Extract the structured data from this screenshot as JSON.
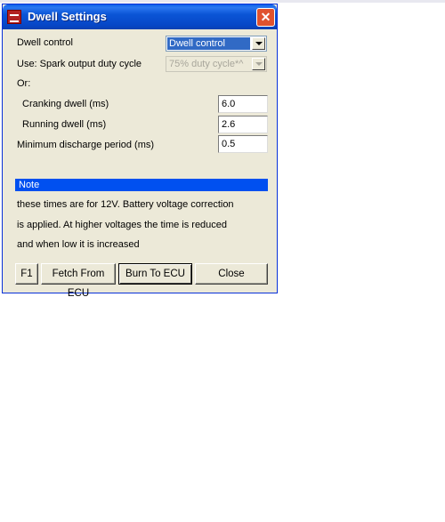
{
  "window": {
    "title": "Dwell Settings",
    "close_glyph": "✕"
  },
  "form": {
    "dwell_control": {
      "label": "Dwell control",
      "value": "Dwell control"
    },
    "duty_cycle": {
      "label": "Use: Spark output duty cycle",
      "value": "75% duty cycle*^"
    },
    "or_label": "Or:",
    "cranking_dwell": {
      "label": "Cranking dwell (ms)",
      "value": "6.0"
    },
    "running_dwell": {
      "label": "Running dwell (ms)",
      "value": "2.6"
    },
    "min_discharge": {
      "label": "Minimum discharge period (ms)",
      "value": "0.5"
    }
  },
  "note": {
    "header": "Note",
    "lines": [
      "these times are for 12V. Battery voltage correction",
      "is applied. At higher voltages the time is reduced",
      "and when low it is increased"
    ]
  },
  "buttons": {
    "f1": "F1",
    "fetch": "Fetch From ECU",
    "burn": "Burn To ECU",
    "close": "Close"
  },
  "colors": {
    "titlebar": "#0a55d6",
    "selection": "#316ac5",
    "note_bar": "#0050f0",
    "dialog_bg": "#ece9d8"
  }
}
